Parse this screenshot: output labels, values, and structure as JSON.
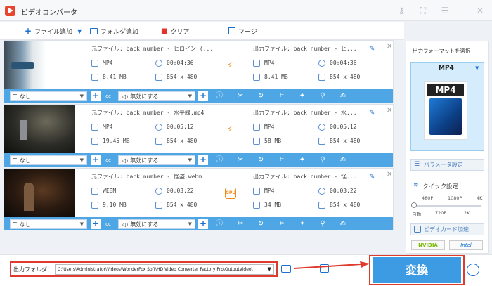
{
  "app": {
    "title": "ビデオコンバータ"
  },
  "toolbar": {
    "add_file": "ファイル追加",
    "add_folder": "フォルダ追加",
    "clear": "クリア",
    "merge": "マージ"
  },
  "files": [
    {
      "source": "元ファイル: back number - ヒロイン (...",
      "src_format": "MP4",
      "src_duration": "00:04:36",
      "src_size": "8.41 MB",
      "src_res": "854 x 480",
      "output": "出力ファイル: back number - ヒ...",
      "out_format": "MP4",
      "out_duration": "00:04:36",
      "out_size": "8.41 MB",
      "out_res": "854 x 480",
      "subtitle": "なし",
      "audio": "無効にする",
      "badge": "bolt"
    },
    {
      "source": "元ファイル: back number - 水平線.mp4",
      "src_format": "MP4",
      "src_duration": "00:05:12",
      "src_size": "19.45 MB",
      "src_res": "854 x 480",
      "output": "出力ファイル: back number - 水...",
      "out_format": "MP4",
      "out_duration": "00:05:12",
      "out_size": "58 MB",
      "out_res": "854 x 480",
      "subtitle": "なし",
      "audio": "無効にする",
      "badge": "bolt"
    },
    {
      "source": "元ファイル: back number - 怪盗.webm",
      "src_format": "WEBM",
      "src_duration": "00:03:22",
      "src_size": "9.10 MB",
      "src_res": "854 x 480",
      "output": "出力ファイル: back number - 怪...",
      "out_format": "MP4",
      "out_duration": "00:03:22",
      "out_size": "34 MB",
      "out_res": "854 x 480",
      "subtitle": "なし",
      "audio": "無効にする",
      "badge": "GPU"
    }
  ],
  "right": {
    "format_title": "出力フォーマットを選択",
    "format": "MP4",
    "format_icon_label": "MP4",
    "param": "パラメータ設定",
    "quick": "クイック設定",
    "q_top": [
      "480P",
      "1080P",
      "4K"
    ],
    "q_bottom": [
      "自動",
      "720P",
      "2K"
    ],
    "gpu_accel": "ビデオカード加速",
    "vendor1": "NVIDIA",
    "vendor2": "Intel"
  },
  "bottom": {
    "output_label": "出力フォルダ：",
    "output_path": "C:\\Users\\Administrator\\Videos\\WonderFox Soft\\HD Video Converter Factory Pro\\OutputVideo\\",
    "convert": "変換"
  }
}
